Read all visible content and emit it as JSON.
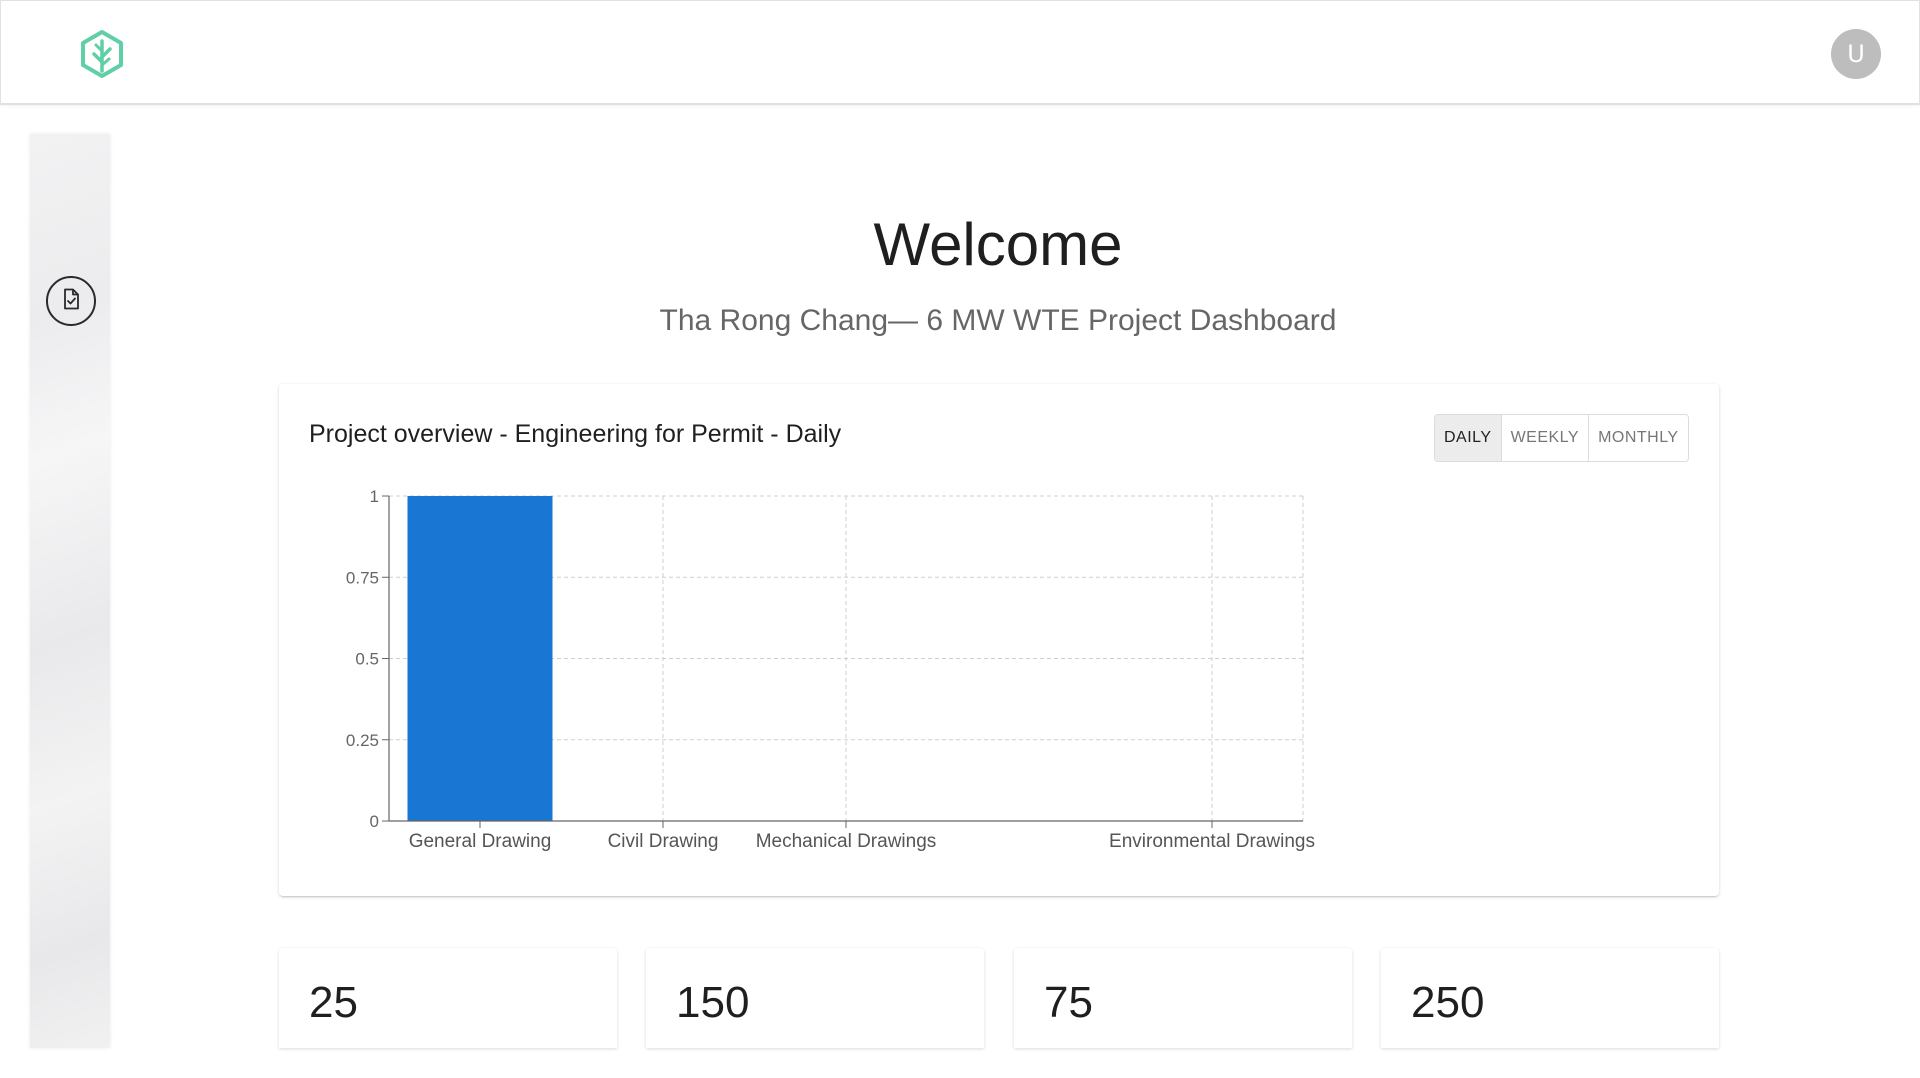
{
  "header": {
    "logo_icon": "leaf-hexagon-icon",
    "brand_color": "#5fcfa6",
    "avatar_initial": "U"
  },
  "sidebar": {
    "items": [
      {
        "icon": "document-check-icon"
      }
    ]
  },
  "page": {
    "title": "Welcome",
    "subtitle": "Tha Rong Chang— 6 MW WTE Project Dashboard"
  },
  "overview": {
    "title": "Project overview - Engineering for Permit - Daily",
    "tabs": [
      {
        "label": "DAILY",
        "active": true
      },
      {
        "label": "WEEKLY",
        "active": false
      },
      {
        "label": "MONTHLY",
        "active": false
      }
    ]
  },
  "chart_data": {
    "type": "bar",
    "categories": [
      "General Drawing",
      "Civil Drawing",
      "Mechanical Drawings",
      "Environmental Drawings"
    ],
    "values": [
      1,
      0,
      0,
      0
    ],
    "yticks": [
      "0",
      "0.25",
      "0.5",
      "0.75",
      "1"
    ],
    "ylim": [
      0,
      1
    ],
    "grid": true,
    "bar_color": "#1976d2"
  },
  "stats": [
    {
      "value": "25"
    },
    {
      "value": "150"
    },
    {
      "value": "75"
    },
    {
      "value": "250"
    }
  ]
}
